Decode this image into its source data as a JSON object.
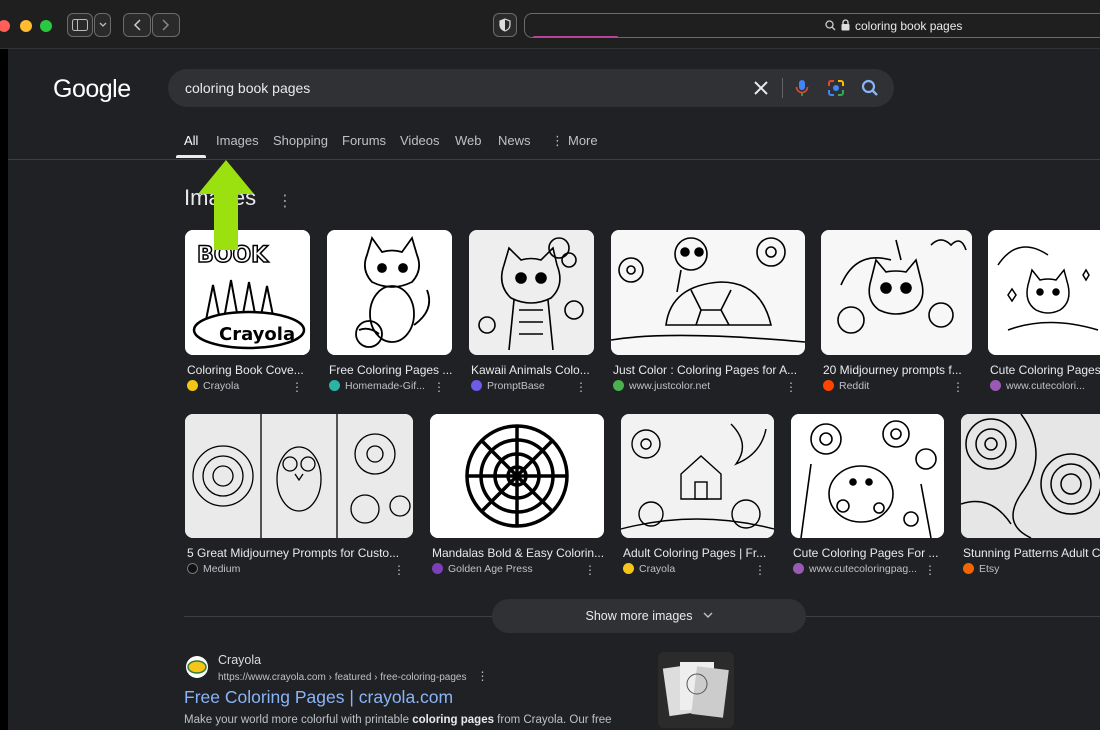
{
  "browser": {
    "address": "coloring book pages",
    "traffic_lights": [
      "#ff5f57",
      "#febc2e",
      "#28c840"
    ]
  },
  "search": {
    "logo": "Google",
    "query": "coloring book pages",
    "tabs": [
      "All",
      "Images",
      "Shopping",
      "Forums",
      "Videos",
      "Web",
      "News",
      "More"
    ],
    "active_tab": "All"
  },
  "images_section": {
    "heading": "Images",
    "row1": [
      {
        "title": "Coloring Book Cove...",
        "source": "Crayola",
        "favicon_color": "#f5c518"
      },
      {
        "title": "Free Coloring Pages ...",
        "source": "Homemade-Gif...",
        "favicon_color": "#2bb3a4"
      },
      {
        "title": "Kawaii Animals Colo...",
        "source": "PromptBase",
        "favicon_color": "#6c5ce7"
      },
      {
        "title": "Just Color : Coloring Pages for A...",
        "source": "www.justcolor.net",
        "favicon_color": "#4caf50"
      },
      {
        "title": "20 Midjourney prompts f...",
        "source": "Reddit",
        "favicon_color": "#ff4500"
      },
      {
        "title": "Cute Coloring Pages",
        "source": "www.cutecolori...",
        "favicon_color": "#9b59b6"
      }
    ],
    "row2": [
      {
        "title": "5 Great Midjourney Prompts for Custo...",
        "source": "Medium",
        "favicon_color": "#111111"
      },
      {
        "title": "Mandalas Bold & Easy Colorin...",
        "source": "Golden Age Press",
        "favicon_color": "#7b3fb6"
      },
      {
        "title": "Adult Coloring Pages | Fr...",
        "source": "Crayola",
        "favicon_color": "#f5c518"
      },
      {
        "title": "Cute Coloring Pages For ...",
        "source": "www.cutecoloringpag...",
        "favicon_color": "#9b59b6"
      },
      {
        "title": "Stunning Patterns Adult C",
        "source": "Etsy",
        "favicon_color": "#f56400"
      }
    ],
    "show_more": "Show more images"
  },
  "result": {
    "site": "Crayola",
    "url": "https://www.crayola.com › featured › free-coloring-pages",
    "title": "Free Coloring Pages | crayola.com",
    "snippet_before": "Make your world more colorful with printable ",
    "snippet_bold": "coloring pages",
    "snippet_after": " from Crayola. Our free"
  },
  "colors": {
    "annotation_arrow": "#9be10f",
    "link": "#8ab4f8",
    "page_background": "#202124"
  }
}
